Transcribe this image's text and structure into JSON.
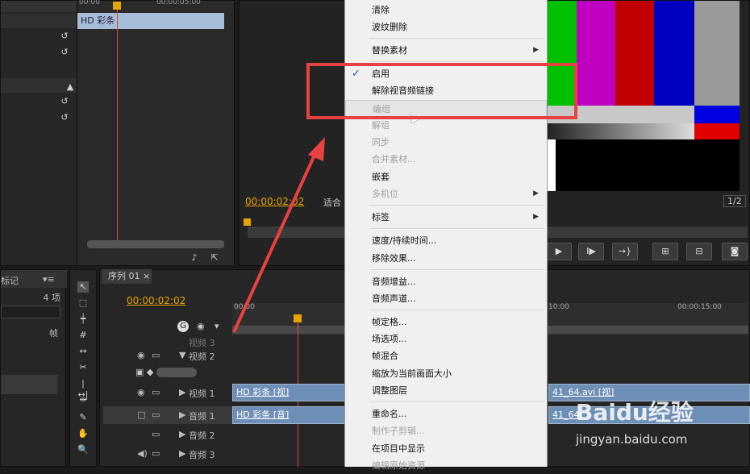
{
  "project": {
    "timecode_head": "00:00",
    "timecode_mid": "00:00:05:00",
    "clip_label": "HD 彩条"
  },
  "monitor": {
    "timecode": "00:00:02:02",
    "fit_label": "适合",
    "zoom_label": "1/2"
  },
  "left_panel": {
    "tab_label": "标记",
    "items_count": "4 项",
    "column_label": "帧"
  },
  "sequence": {
    "tab_label": "序列 01",
    "timecode": "00:00:02:02",
    "ruler": [
      "00:00",
      "10:00",
      "00:00:15:00"
    ]
  },
  "tracks": [
    {
      "name": "视频 3"
    },
    {
      "name": "视频 2"
    },
    {
      "name": "视频 1",
      "clip": "HD 彩条 [视]",
      "clip2": "41_64.avi [视]"
    },
    {
      "name": "音频 1",
      "clip": "HD 彩条 [音]",
      "clip2": "41_64"
    },
    {
      "name": "音频 2"
    },
    {
      "name": "音频 3"
    }
  ],
  "context_menu": {
    "items": [
      {
        "label": "清除",
        "enabled": true
      },
      {
        "label": "波纹删除",
        "enabled": true
      },
      {
        "label": "替换素材",
        "enabled": true,
        "submenu": true
      },
      {
        "label": "启用",
        "enabled": true,
        "checked": true
      },
      {
        "label": "解除视音频链接",
        "enabled": true
      },
      {
        "label": "编组",
        "enabled": false
      },
      {
        "label": "解组",
        "enabled": false
      },
      {
        "label": "同步",
        "enabled": false
      },
      {
        "label": "合并素材...",
        "enabled": false
      },
      {
        "label": "嵌套",
        "enabled": true
      },
      {
        "label": "多机位",
        "enabled": false,
        "submenu": true
      },
      {
        "label": "标签",
        "enabled": true,
        "submenu": true
      },
      {
        "label": "速度/持续时间...",
        "enabled": true
      },
      {
        "label": "移除效果...",
        "enabled": true
      },
      {
        "label": "音频增益...",
        "enabled": true
      },
      {
        "label": "音频声道...",
        "enabled": true
      },
      {
        "label": "帧定格...",
        "enabled": true
      },
      {
        "label": "场选项...",
        "enabled": true
      },
      {
        "label": "帧混合",
        "enabled": true
      },
      {
        "label": "缩放为当前画面大小",
        "enabled": true
      },
      {
        "label": "调整图层",
        "enabled": true
      },
      {
        "label": "重命名...",
        "enabled": true
      },
      {
        "label": "制作子剪辑...",
        "enabled": false
      },
      {
        "label": "在项目中显示",
        "enabled": true
      },
      {
        "label": "编辑原始资源",
        "enabled": false
      }
    ]
  },
  "watermark": {
    "brand": "Baidu经验",
    "url": "jingyan.baidu.com"
  },
  "colors": {
    "timecode": "#e8a400",
    "highlight_box": "#e84141",
    "clip": "#6e8fb5"
  }
}
